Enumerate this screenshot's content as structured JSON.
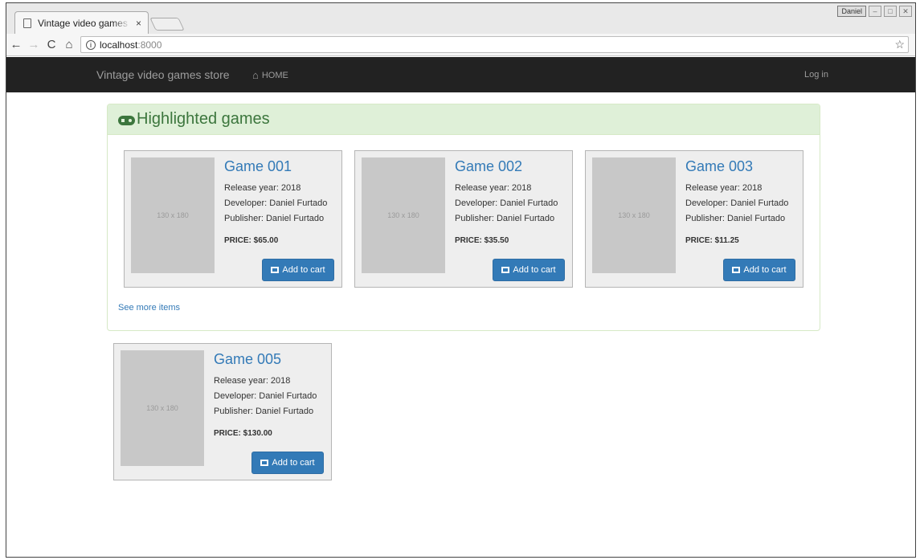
{
  "browser": {
    "tab_title": "Vintage video games",
    "tab_close": "×",
    "profile_name": "Daniel",
    "address_host": "localhost",
    "address_port": ":8000"
  },
  "navbar": {
    "brand": "Vintage video games store",
    "home_label": "HOME",
    "login_label": "Log in"
  },
  "highlights": {
    "title": "Highlighted games",
    "see_more": "See more items",
    "games": [
      {
        "title": "Game 001",
        "release": "Release year: 2018",
        "developer": "Developer: Daniel Furtado",
        "publisher": "Publisher: Daniel Furtado",
        "price": "PRICE: $65.00",
        "thumb": "130 x 180",
        "cart_label": "Add to cart"
      },
      {
        "title": "Game 002",
        "release": "Release year: 2018",
        "developer": "Developer: Daniel Furtado",
        "publisher": "Publisher: Daniel Furtado",
        "price": "PRICE: $35.50",
        "thumb": "130 x 180",
        "cart_label": "Add to cart"
      },
      {
        "title": "Game 003",
        "release": "Release year: 2018",
        "developer": "Developer: Daniel Furtado",
        "publisher": "Publisher: Daniel Furtado",
        "price": "PRICE: $11.25",
        "thumb": "130 x 180",
        "cart_label": "Add to cart"
      }
    ]
  },
  "more_games": [
    {
      "title": "Game 005",
      "release": "Release year: 2018",
      "developer": "Developer: Daniel Furtado",
      "publisher": "Publisher: Daniel Furtado",
      "price": "PRICE: $130.00",
      "thumb": "130 x 180",
      "cart_label": "Add to cart"
    }
  ]
}
